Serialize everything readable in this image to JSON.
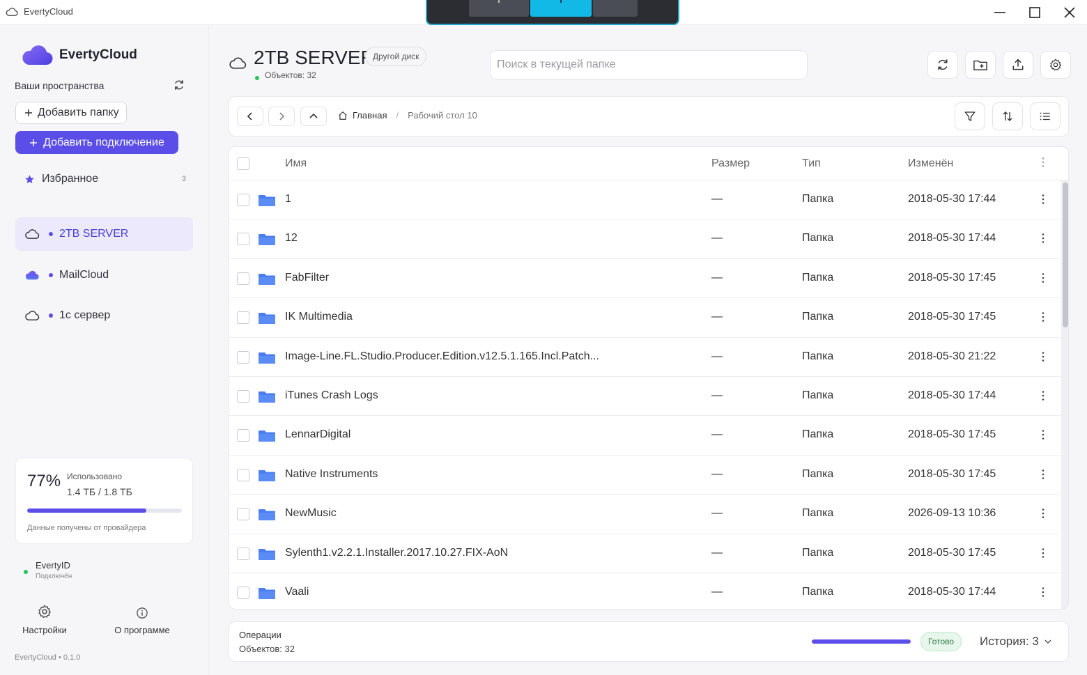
{
  "window": {
    "title": "EvertyCloud"
  },
  "sidebar": {
    "brand": "EvertyCloud",
    "spaces_label": "Ваши пространства",
    "add_folder_label": "Добавить папку",
    "add_connection_label": "Добавить подключение",
    "favorites": {
      "label": "Избранное",
      "count": "3"
    },
    "connections": [
      {
        "label": "2TB SERVER",
        "icon": "cloud-outline-icon",
        "active": true
      },
      {
        "label": "MailCloud",
        "icon": "cloud-filled-icon",
        "active": false
      },
      {
        "label": "1с сервер",
        "icon": "cloud-outline-icon",
        "active": false
      }
    ],
    "storage": {
      "percent_label": "77%",
      "used_fraction": 0.77,
      "used_label": "Использовано",
      "used_value": "1.4 ТБ / 1.8 ТБ",
      "note": "Данные получены от провайдера"
    },
    "everty_id": {
      "name": "EvertyID",
      "status": "Подключён"
    },
    "settings_label": "Настройки",
    "about_label": "О программе",
    "version": "EvertyCloud • 0.1.0"
  },
  "header": {
    "title": "2TB SERVER",
    "badge": "Другой диск",
    "count": "Объектов: 32",
    "search_placeholder": "Поиск в текущей папке"
  },
  "breadcrumb": {
    "home": "Главная",
    "separator": "/",
    "current": "Рабочий стол 10"
  },
  "table": {
    "columns": {
      "name": "Имя",
      "size": "Размер",
      "type": "Тип",
      "modified": "Изменён"
    },
    "rows": [
      {
        "name": "1",
        "size": "—",
        "type": "Папка",
        "modified": "2018-05-30 17:44"
      },
      {
        "name": "12",
        "size": "—",
        "type": "Папка",
        "modified": "2018-05-30 17:44"
      },
      {
        "name": "FabFilter",
        "size": "—",
        "type": "Папка",
        "modified": "2018-05-30 17:45"
      },
      {
        "name": "IK Multimedia",
        "size": "—",
        "type": "Папка",
        "modified": "2018-05-30 17:45"
      },
      {
        "name": "Image-Line.FL.Studio.Producer.Edition.v12.5.1.165.Incl.Patch...",
        "size": "—",
        "type": "Папка",
        "modified": "2018-05-30 21:22"
      },
      {
        "name": "iTunes Crash Logs",
        "size": "—",
        "type": "Папка",
        "modified": "2018-05-30 17:44"
      },
      {
        "name": "LennarDigital",
        "size": "—",
        "type": "Папка",
        "modified": "2018-05-30 17:45"
      },
      {
        "name": "Native Instruments",
        "size": "—",
        "type": "Папка",
        "modified": "2018-05-30 17:45"
      },
      {
        "name": "NewMusic",
        "size": "—",
        "type": "Папка",
        "modified": "2026-09-13 10:36"
      },
      {
        "name": "Sylenth1.v2.2.1.Installer.2017.10.27.FIX-AoN",
        "size": "—",
        "type": "Папка",
        "modified": "2018-05-30 17:45"
      },
      {
        "name": "Vaali",
        "size": "—",
        "type": "Папка",
        "modified": "2018-05-30 17:44"
      }
    ]
  },
  "operations": {
    "title": "Операции",
    "count": "Объектов: 32",
    "progress_fraction": 1.0,
    "status": "Готово",
    "history": "История: 3"
  },
  "colors": {
    "accent": "#5a4de8",
    "folder": "#4a7ef0",
    "online": "#22c55e"
  }
}
